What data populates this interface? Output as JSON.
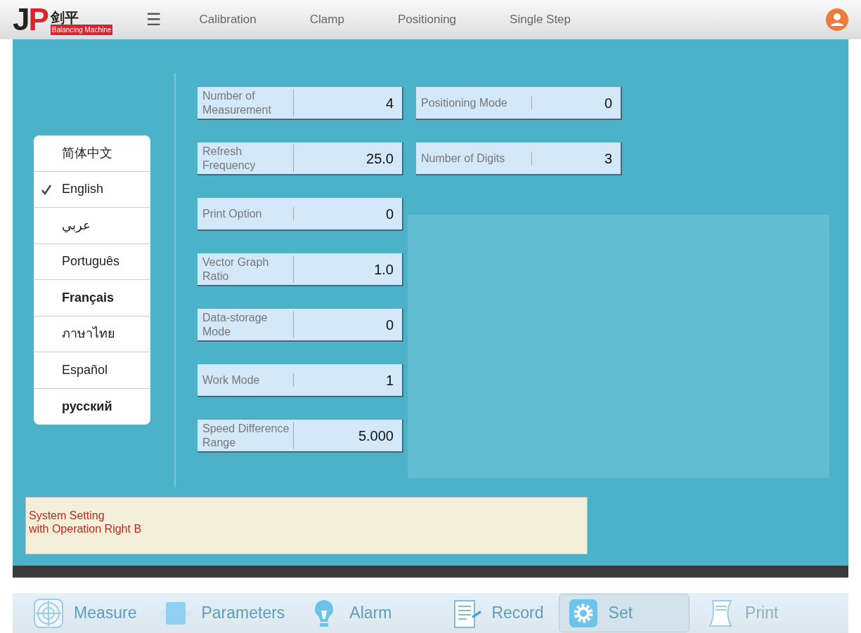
{
  "header": {
    "logo": {
      "letters": "JP",
      "chinese": "剑平",
      "subtitle": "Balancing Machine"
    },
    "menu_icon": "☰",
    "tabs": [
      {
        "label": "Calibration",
        "selected": false
      },
      {
        "label": "Clamp",
        "selected": false
      },
      {
        "label": "Positioning",
        "selected": false
      },
      {
        "label": "Single Step",
        "selected": false
      }
    ]
  },
  "languages": [
    {
      "label": "简体中文",
      "checked": false
    },
    {
      "label": "English",
      "checked": true
    },
    {
      "label": "عربي",
      "checked": false
    },
    {
      "label": "Português",
      "checked": false
    },
    {
      "label": "Français",
      "checked": false
    },
    {
      "label": "ภาษาไทย",
      "checked": false
    },
    {
      "label": "Español",
      "checked": false
    },
    {
      "label": "русский",
      "checked": false
    }
  ],
  "parameters_left": [
    {
      "label": "Number of Measurement",
      "value": "4"
    },
    {
      "label": "Refresh Frequency",
      "value": "25.0"
    },
    {
      "label": "Print Option",
      "value": "0"
    },
    {
      "label": "Vector Graph Ratio",
      "value": "1.0"
    },
    {
      "label": "Data-storage Mode",
      "value": "0"
    },
    {
      "label": "Work Mode",
      "value": "1"
    },
    {
      "label": "Speed Difference Range",
      "value": "5.000"
    }
  ],
  "parameters_right": [
    {
      "label": "Positioning Mode",
      "value": "0"
    },
    {
      "label": "Number of Digits",
      "value": "3"
    }
  ],
  "message": [
    "System Setting",
    "with Operation Right B"
  ],
  "bottom_nav": [
    {
      "label": "Measure",
      "kind": "radar",
      "selected": false,
      "disabled": false
    },
    {
      "label": "Parameters",
      "kind": "block",
      "selected": false,
      "disabled": false
    },
    {
      "label": "Alarm",
      "kind": "bulb",
      "selected": false,
      "disabled": false
    },
    {
      "label": "Record",
      "kind": "note",
      "selected": false,
      "disabled": false
    },
    {
      "label": "Set",
      "kind": "gear",
      "selected": true,
      "disabled": false
    },
    {
      "label": "Print",
      "kind": "scroll",
      "selected": false,
      "disabled": true
    }
  ]
}
